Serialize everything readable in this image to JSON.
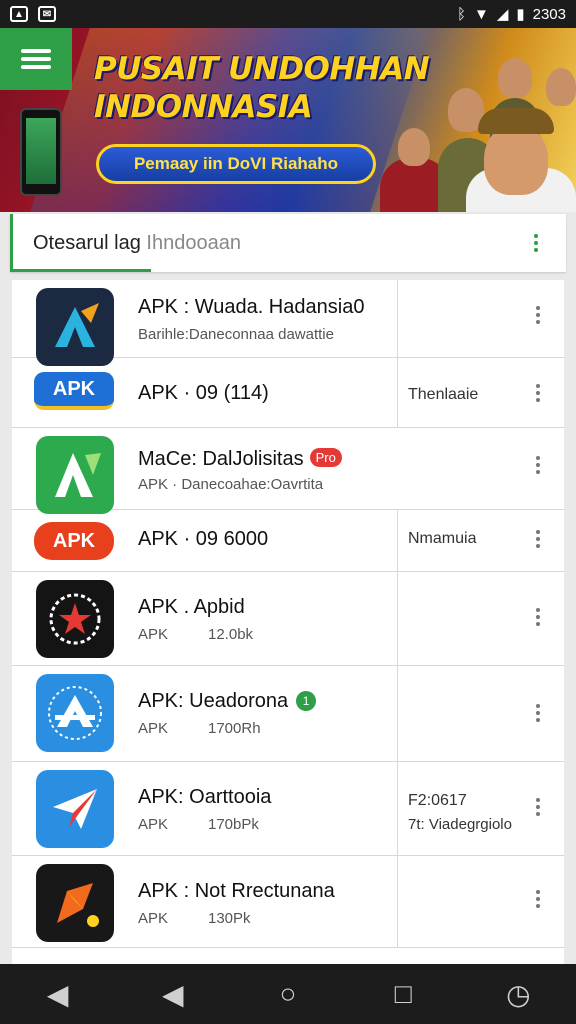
{
  "status_bar": {
    "left_icons": [
      "photo-icon",
      "message-icon"
    ],
    "right_icons": [
      "bluetooth-icon",
      "wifi-icon",
      "signal-icon",
      "battery-icon"
    ],
    "time": "2303"
  },
  "banner": {
    "title": "PUSAIT UNDOHHAN INDONNASIA",
    "button_label": "Pemaay iin DoVI Riahaho",
    "colors": {
      "red": "#a8162a",
      "blue": "#1d3fa8",
      "gold": "#ffd21f"
    }
  },
  "search": {
    "value": "Otesarul lag",
    "placeholder": "Ihndooaan"
  },
  "accent_color": "#2e9e47",
  "list": [
    {
      "title": "APK : Wuada. Hadansia0",
      "subtitle": "Barihle:Daneconnaa dawattie",
      "icon": "arrow-a-icon"
    },
    {
      "badge": "APK",
      "title": "APK · 09 (114)",
      "side": "Thenlaaie"
    },
    {
      "title": "MaCe: DalJolisitas",
      "pro": "Pro",
      "subtitle": "APK · Danecoahae:Oavrtita",
      "icon": "green-a-icon"
    },
    {
      "badge": "APK",
      "title": "APK · 09 6000",
      "side": "Nmamuia"
    },
    {
      "title": "APK . Apbid",
      "sub1": "APK",
      "sub2": "12.0bk",
      "icon": "star-emblem-icon"
    },
    {
      "title": "APK: Ueadorona",
      "num": "1",
      "sub1": "APK",
      "sub2": "1700Rh",
      "icon": "blue-a-icon"
    },
    {
      "title": "APK: Oarttooia",
      "sub1": "APK",
      "sub2": "170bPk",
      "side": "F2:0617",
      "side2": "7t: Viadegrgiolo",
      "icon": "paper-plane-icon"
    },
    {
      "title": "APK : Not Rrectunana",
      "sub1": "APK",
      "sub2": "130Pk",
      "icon": "game-arrow-icon"
    }
  ],
  "nav_bar": [
    "back-icon",
    "back-icon",
    "home-icon",
    "recents-icon",
    "clock-icon"
  ]
}
